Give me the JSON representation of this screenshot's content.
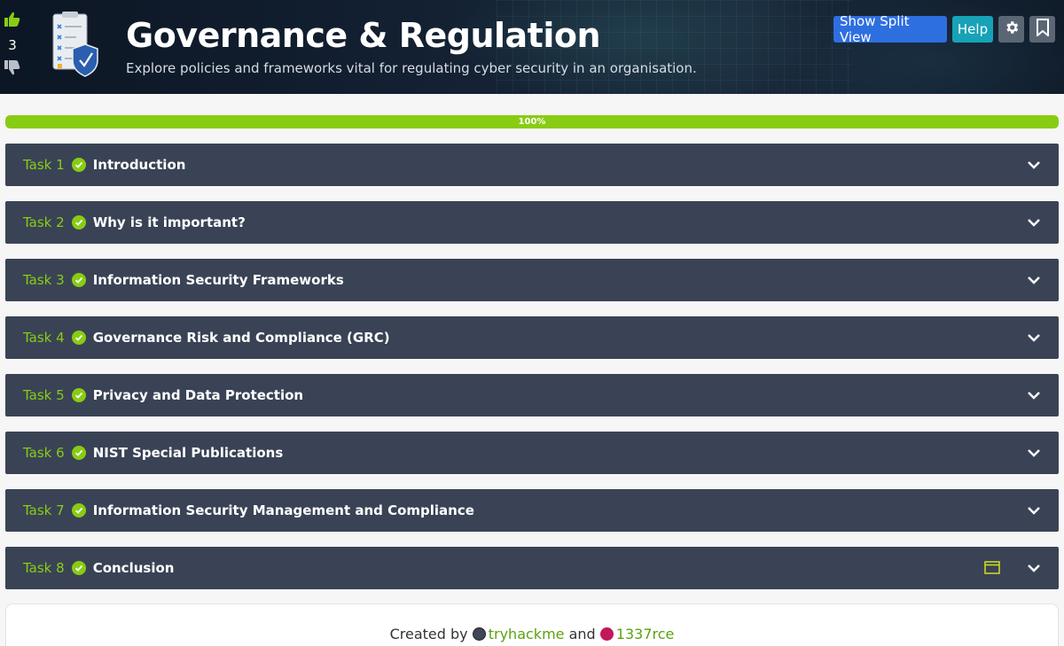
{
  "header": {
    "title": "Governance & Regulation",
    "subtitle": "Explore policies and frameworks vital for regulating cyber security in an organisation.",
    "vote_count": "3",
    "buttons": {
      "split_view": "Show Split View",
      "help": "Help"
    }
  },
  "progress": {
    "percent": 100,
    "label": "100%"
  },
  "tasks": [
    {
      "num": "Task 1",
      "name": "Introduction",
      "completed": true
    },
    {
      "num": "Task 2",
      "name": "Why is it important?",
      "completed": true
    },
    {
      "num": "Task 3",
      "name": "Information Security Frameworks",
      "completed": true
    },
    {
      "num": "Task 4",
      "name": "Governance Risk and Compliance (GRC)",
      "completed": true
    },
    {
      "num": "Task 5",
      "name": "Privacy and Data Protection",
      "completed": true
    },
    {
      "num": "Task 6",
      "name": "NIST Special Publications",
      "completed": true
    },
    {
      "num": "Task 7",
      "name": "Information Security Management and Compliance",
      "completed": true
    },
    {
      "num": "Task 8",
      "name": "Conclusion",
      "completed": true,
      "has_window_icon": true
    }
  ],
  "footer": {
    "created_by": "Created by",
    "author1": "tryhackme",
    "and": "and",
    "author2": "1337rce"
  },
  "colors": {
    "accent_green": "#88cc14",
    "task_bg": "#3a4355",
    "primary_button": "#2e6fe0",
    "help_button": "#17a2b8"
  },
  "icons": [
    "thumbs-up-icon",
    "thumbs-down-icon",
    "room-checklist-icon",
    "gear-icon",
    "bookmark-icon",
    "check-circle-icon",
    "chevron-down-icon",
    "window-icon"
  ]
}
